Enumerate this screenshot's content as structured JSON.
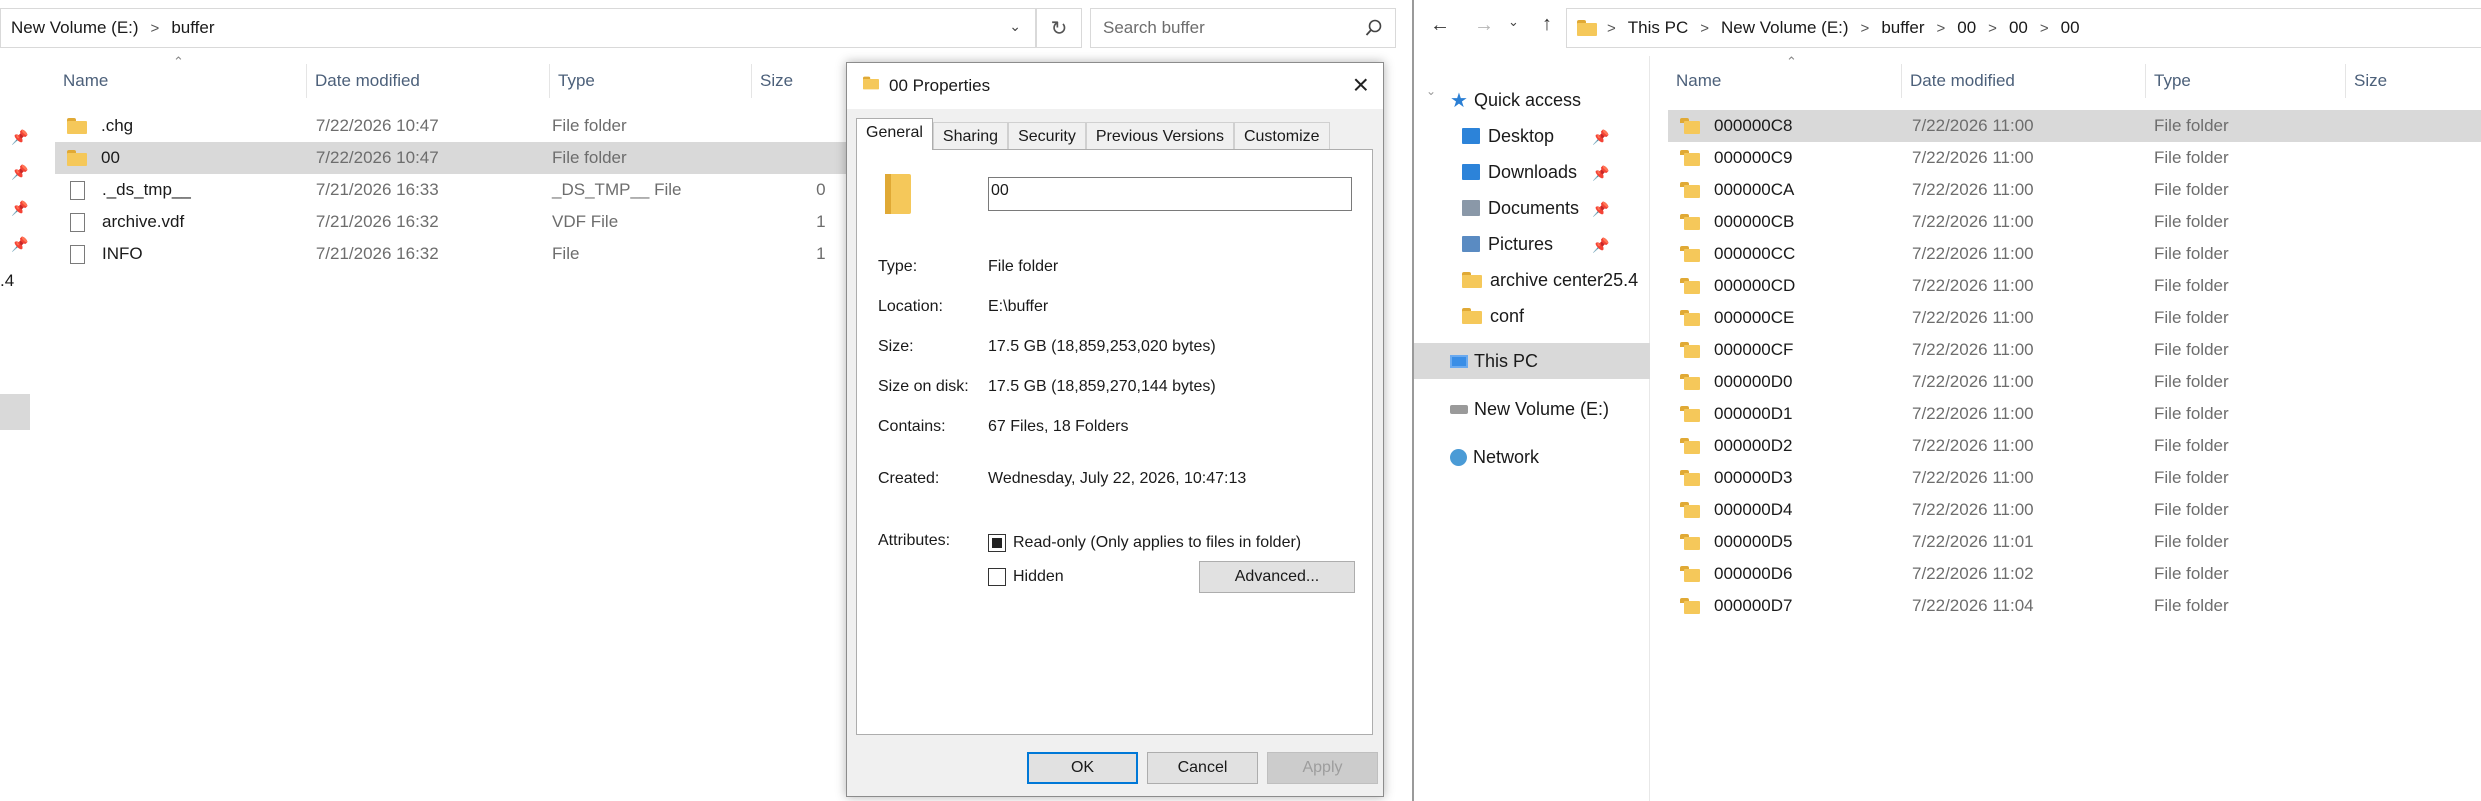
{
  "left": {
    "address": [
      "New Volume (E:)",
      "buffer"
    ],
    "search_placeholder": "Search buffer",
    "columns": [
      "Name",
      "Date modified",
      "Type",
      "Size"
    ],
    "rows": [
      {
        "name": ".chg",
        "date": "7/22/2026 10:47",
        "type": "File folder",
        "size": "",
        "icon": "folder-icon",
        "selected": false
      },
      {
        "name": "00",
        "date": "7/22/2026 10:47",
        "type": "File folder",
        "size": "",
        "icon": "folder-icon",
        "selected": true
      },
      {
        "name": "._ds_tmp__",
        "date": "7/21/2026 16:33",
        "type": "_DS_TMP__ File",
        "size": "0",
        "icon": "file-icon",
        "selected": false
      },
      {
        "name": "archive.vdf",
        "date": "7/21/2026 16:32",
        "type": "VDF File",
        "size": "1",
        "icon": "file-icon",
        "selected": false
      },
      {
        "name": "INFO",
        "date": "7/21/2026 16:32",
        "type": "File",
        "size": "1",
        "icon": "file-icon",
        "selected": false
      }
    ],
    "sidebar_fragment": ".4"
  },
  "dialog": {
    "title": "00 Properties",
    "tabs": [
      "General",
      "Sharing",
      "Security",
      "Previous Versions",
      "Customize"
    ],
    "name_value": "00",
    "props": [
      {
        "label": "Type:",
        "value": "File folder"
      },
      {
        "label": "Location:",
        "value": "E:\\buffer"
      },
      {
        "label": "Size:",
        "value": "17.5 GB (18,859,253,020 bytes)"
      },
      {
        "label": "Size on disk:",
        "value": "17.5 GB (18,859,270,144 bytes)"
      },
      {
        "label": "Contains:",
        "value": "67 Files, 18 Folders"
      }
    ],
    "created_label": "Created:",
    "created_value": "Wednesday, July 22, 2026, 10:47:13",
    "attributes_label": "Attributes:",
    "readonly_label": "Read-only (Only applies to files in folder)",
    "hidden_label": "Hidden",
    "advanced_label": "Advanced...",
    "ok_label": "OK",
    "cancel_label": "Cancel",
    "apply_label": "Apply"
  },
  "right": {
    "address": [
      "This PC",
      "New Volume (E:)",
      "buffer",
      "00",
      "00",
      "00"
    ],
    "nav": {
      "quick_access": "Quick access",
      "items": [
        {
          "label": "Desktop",
          "pinned": true
        },
        {
          "label": "Downloads",
          "pinned": true
        },
        {
          "label": "Documents",
          "pinned": true
        },
        {
          "label": "Pictures",
          "pinned": true
        },
        {
          "label": "archive center25.4",
          "pinned": false
        },
        {
          "label": "conf",
          "pinned": false
        }
      ],
      "this_pc": "This PC",
      "volume": "New Volume (E:)",
      "network": "Network"
    },
    "columns": [
      "Name",
      "Date modified",
      "Type",
      "Size"
    ],
    "rows": [
      {
        "name": "000000C8",
        "date": "7/22/2026 11:00",
        "type": "File folder"
      },
      {
        "name": "000000C9",
        "date": "7/22/2026 11:00",
        "type": "File folder"
      },
      {
        "name": "000000CA",
        "date": "7/22/2026 11:00",
        "type": "File folder"
      },
      {
        "name": "000000CB",
        "date": "7/22/2026 11:00",
        "type": "File folder"
      },
      {
        "name": "000000CC",
        "date": "7/22/2026 11:00",
        "type": "File folder"
      },
      {
        "name": "000000CD",
        "date": "7/22/2026 11:00",
        "type": "File folder"
      },
      {
        "name": "000000CE",
        "date": "7/22/2026 11:00",
        "type": "File folder"
      },
      {
        "name": "000000CF",
        "date": "7/22/2026 11:00",
        "type": "File folder"
      },
      {
        "name": "000000D0",
        "date": "7/22/2026 11:00",
        "type": "File folder"
      },
      {
        "name": "000000D1",
        "date": "7/22/2026 11:00",
        "type": "File folder"
      },
      {
        "name": "000000D2",
        "date": "7/22/2026 11:00",
        "type": "File folder"
      },
      {
        "name": "000000D3",
        "date": "7/22/2026 11:00",
        "type": "File folder"
      },
      {
        "name": "000000D4",
        "date": "7/22/2026 11:00",
        "type": "File folder"
      },
      {
        "name": "000000D5",
        "date": "7/22/2026 11:01",
        "type": "File folder"
      },
      {
        "name": "000000D6",
        "date": "7/22/2026 11:02",
        "type": "File folder"
      },
      {
        "name": "000000D7",
        "date": "7/22/2026 11:04",
        "type": "File folder"
      }
    ]
  },
  "colors": {
    "selection": "#d9d9d9",
    "accent": "#0078d7",
    "folder": "#f5c85a"
  }
}
